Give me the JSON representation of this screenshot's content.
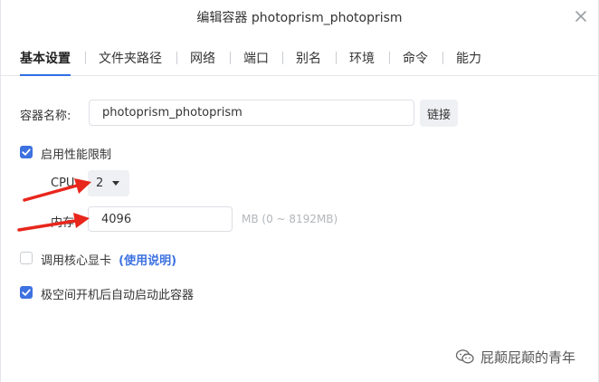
{
  "dialog": {
    "title": "编辑容器 photoprism_photoprism"
  },
  "tabs": [
    {
      "label": "基本设置",
      "active": true
    },
    {
      "label": "文件夹路径"
    },
    {
      "label": "网络"
    },
    {
      "label": "端口"
    },
    {
      "label": "别名"
    },
    {
      "label": "环境"
    },
    {
      "label": "命令"
    },
    {
      "label": "能力"
    }
  ],
  "container_name": {
    "label": "容器名称:",
    "value": "photoprism_photoprism",
    "link_button": "链接"
  },
  "performance_limit": {
    "checkbox_label": "启用性能限制",
    "checked": true,
    "cpu_label": "CPU:",
    "cpu_value": "2",
    "memory_label": "内存:",
    "memory_value": "4096",
    "memory_hint": "MB (0 ~ 8192MB)"
  },
  "gpu": {
    "checkbox_label": "调用核心显卡",
    "checked": false,
    "help_link": "(使用说明)"
  },
  "autostart": {
    "checkbox_label": "极空间开机后自动启动此容器",
    "checked": true
  },
  "watermark": {
    "text": "屁颠屁颠的青年"
  },
  "colors": {
    "accent": "#3d72e0",
    "annotation_arrow": "#e8261c"
  },
  "icons": {
    "close": "close-icon",
    "checkbox": "check-icon",
    "dropdown": "caret-down-icon",
    "watermark": "wechat-icon"
  }
}
